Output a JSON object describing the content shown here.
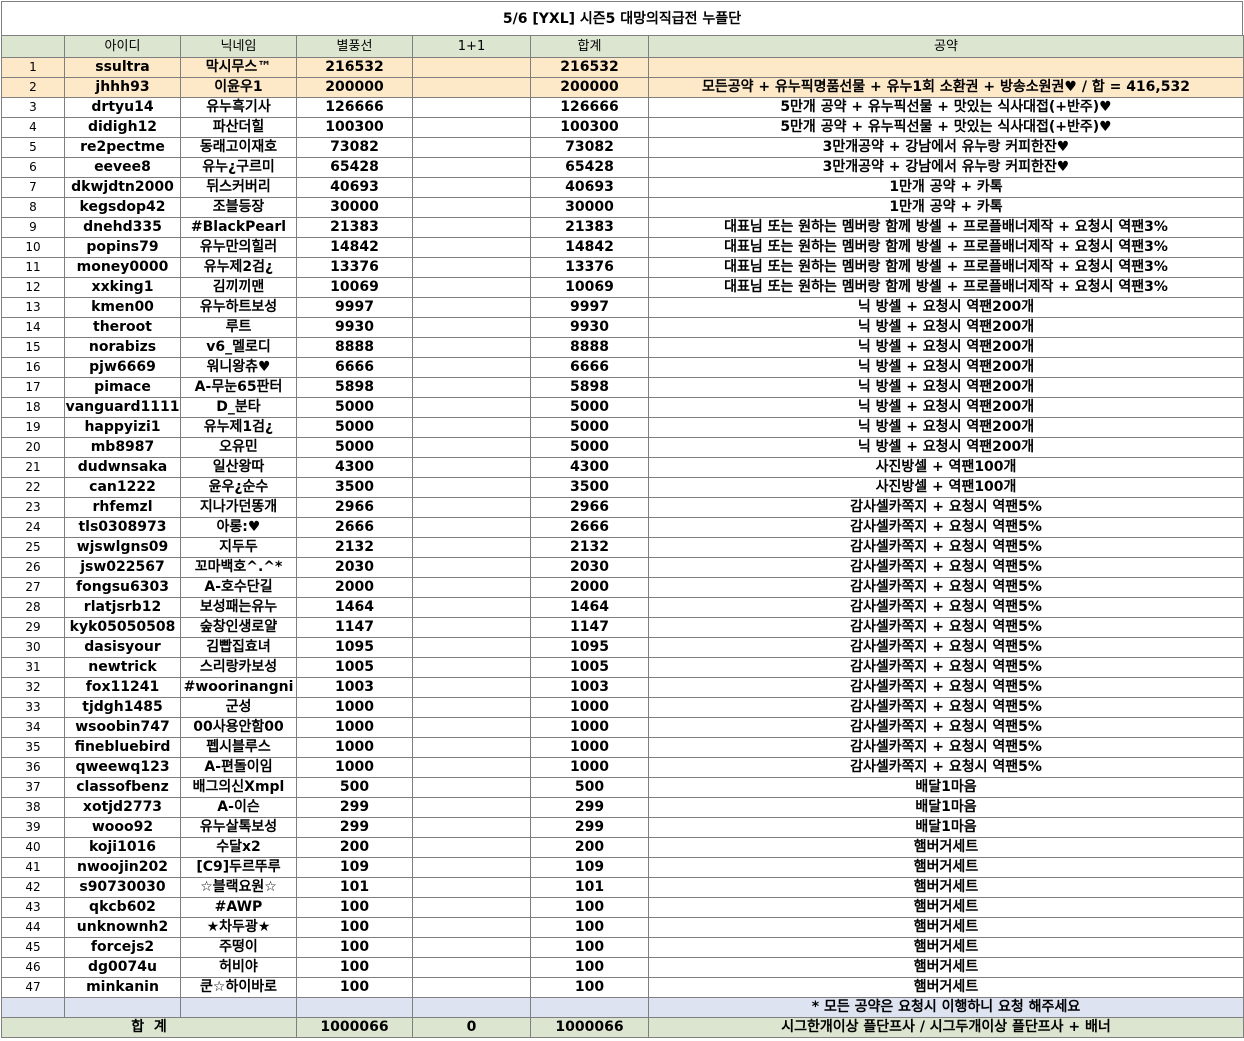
{
  "title": "5/6 [YXL] 시즌5 대망의직급전 누플단",
  "headers": [
    "",
    "아이디",
    "닉네임",
    "별풍선",
    "1+1",
    "합계",
    "공약"
  ],
  "rows": [
    {
      "no": "1",
      "id": "ssultra",
      "nick": "막시무스™",
      "stars": "216532",
      "plus": "",
      "total": "216532",
      "pledge": ""
    },
    {
      "no": "2",
      "id": "jhhh93",
      "nick": "이윤우1",
      "stars": "200000",
      "plus": "",
      "total": "200000",
      "pledge": "모든공약 + 유누픽명품선물 + 유누1회 소환권 + 방송소원권♥ / 합 = 416,532"
    },
    {
      "no": "3",
      "id": "drtyu14",
      "nick": "유누흑기사",
      "stars": "126666",
      "plus": "",
      "total": "126666",
      "pledge": "5만개 공약 + 유누픽선물 + 맛있는 식사대접(+반주)♥"
    },
    {
      "no": "4",
      "id": "didigh12",
      "nick": "파산더힐",
      "stars": "100300",
      "plus": "",
      "total": "100300",
      "pledge": "5만개 공약 + 유누픽선물 + 맛있는 식사대접(+반주)♥"
    },
    {
      "no": "5",
      "id": "re2pectme",
      "nick": "동래고이재호",
      "stars": "73082",
      "plus": "",
      "total": "73082",
      "pledge": "3만개공약 + 강남에서 유누랑 커피한잔♥"
    },
    {
      "no": "6",
      "id": "eevee8",
      "nick": "유누¿구르미",
      "stars": "65428",
      "plus": "",
      "total": "65428",
      "pledge": "3만개공약 + 강남에서 유누랑 커피한잔♥"
    },
    {
      "no": "7",
      "id": "dkwjdtn2000",
      "nick": "뒤스커버리",
      "stars": "40693",
      "plus": "",
      "total": "40693",
      "pledge": "1만개 공약 + 카톡"
    },
    {
      "no": "8",
      "id": "kegsdop42",
      "nick": "조블등장",
      "stars": "30000",
      "plus": "",
      "total": "30000",
      "pledge": "1만개 공약 + 카톡"
    },
    {
      "no": "9",
      "id": "dnehd335",
      "nick": "#BlackPearl",
      "stars": "21383",
      "plus": "",
      "total": "21383",
      "pledge": "대표님 또는 원하는 멤버랑 함께 방셀 + 프로플배너제작 + 요청시 역팬3%"
    },
    {
      "no": "10",
      "id": "popins79",
      "nick": "유누만의힐러",
      "stars": "14842",
      "plus": "",
      "total": "14842",
      "pledge": "대표님 또는 원하는 멤버랑 함께 방셀 + 프로플배너제작 + 요청시 역팬3%"
    },
    {
      "no": "11",
      "id": "money0000",
      "nick": "유누제2검¿",
      "stars": "13376",
      "plus": "",
      "total": "13376",
      "pledge": "대표님 또는 원하는 멤버랑 함께 방셀 + 프로플배너제작 + 요청시 역팬3%"
    },
    {
      "no": "12",
      "id": "xxking1",
      "nick": "김끼끼맨",
      "stars": "10069",
      "plus": "",
      "total": "10069",
      "pledge": "대표님 또는 원하는 멤버랑 함께 방셀 + 프로플배너제작 + 요청시 역팬3%"
    },
    {
      "no": "13",
      "id": "kmen00",
      "nick": "유누하트보성",
      "stars": "9997",
      "plus": "",
      "total": "9997",
      "pledge": "닉 방셀 + 요청시 역팬200개"
    },
    {
      "no": "14",
      "id": "theroot",
      "nick": "루트",
      "stars": "9930",
      "plus": "",
      "total": "9930",
      "pledge": "닉 방셀 + 요청시 역팬200개"
    },
    {
      "no": "15",
      "id": "norabizs",
      "nick": "v6_멜로디",
      "stars": "8888",
      "plus": "",
      "total": "8888",
      "pledge": "닉 방셀 + 요청시 역팬200개"
    },
    {
      "no": "16",
      "id": "pjw6669",
      "nick": "워니왕츄♥",
      "stars": "6666",
      "plus": "",
      "total": "6666",
      "pledge": "닉 방셀 + 요청시 역팬200개"
    },
    {
      "no": "17",
      "id": "pimace",
      "nick": "A-무눈65판터",
      "stars": "5898",
      "plus": "",
      "total": "5898",
      "pledge": "닉 방셀 + 요청시 역팬200개"
    },
    {
      "no": "18",
      "id": "vanguard1111",
      "nick": "D_분타",
      "stars": "5000",
      "plus": "",
      "total": "5000",
      "pledge": "닉 방셀 + 요청시 역팬200개"
    },
    {
      "no": "19",
      "id": "happyizi1",
      "nick": "유누제1검¿",
      "stars": "5000",
      "plus": "",
      "total": "5000",
      "pledge": "닉 방셀 + 요청시 역팬200개"
    },
    {
      "no": "20",
      "id": "mb8987",
      "nick": "오유민",
      "stars": "5000",
      "plus": "",
      "total": "5000",
      "pledge": "닉 방셀 + 요청시 역팬200개"
    },
    {
      "no": "21",
      "id": "dudwnsaka",
      "nick": "일산왕따",
      "stars": "4300",
      "plus": "",
      "total": "4300",
      "pledge": "사진방셀 + 역팬100개"
    },
    {
      "no": "22",
      "id": "can1222",
      "nick": "윤우¿순수",
      "stars": "3500",
      "plus": "",
      "total": "3500",
      "pledge": "사진방셀 + 역팬100개"
    },
    {
      "no": "23",
      "id": "rhfemzl",
      "nick": "지나가던똥개",
      "stars": "2966",
      "plus": "",
      "total": "2966",
      "pledge": "감사셀카쪽지 + 요청시 역팬5%"
    },
    {
      "no": "24",
      "id": "tls0308973",
      "nick": "아롱:♥",
      "stars": "2666",
      "plus": "",
      "total": "2666",
      "pledge": "감사셀카쪽지 + 요청시 역팬5%"
    },
    {
      "no": "25",
      "id": "wjswlgns09",
      "nick": "지두두",
      "stars": "2132",
      "plus": "",
      "total": "2132",
      "pledge": "감사셀카쪽지 + 요청시 역팬5%"
    },
    {
      "no": "26",
      "id": "jsw022567",
      "nick": "꼬마백호^.^*",
      "stars": "2030",
      "plus": "",
      "total": "2030",
      "pledge": "감사셀카쪽지 + 요청시 역팬5%"
    },
    {
      "no": "27",
      "id": "fongsu6303",
      "nick": "A-호수단길",
      "stars": "2000",
      "plus": "",
      "total": "2000",
      "pledge": "감사셀카쪽지 + 요청시 역팬5%"
    },
    {
      "no": "28",
      "id": "rlatjsrb12",
      "nick": "보성패는유누",
      "stars": "1464",
      "plus": "",
      "total": "1464",
      "pledge": "감사셀카쪽지 + 요청시 역팬5%"
    },
    {
      "no": "29",
      "id": "kyk05050508",
      "nick": "숲창인생로얄",
      "stars": "1147",
      "plus": "",
      "total": "1147",
      "pledge": "감사셀카쪽지 + 요청시 역팬5%"
    },
    {
      "no": "30",
      "id": "dasisyour",
      "nick": "김빱집효녀",
      "stars": "1095",
      "plus": "",
      "total": "1095",
      "pledge": "감사셀카쪽지 + 요청시 역팬5%"
    },
    {
      "no": "31",
      "id": "newtrick",
      "nick": "스리랑카보성",
      "stars": "1005",
      "plus": "",
      "total": "1005",
      "pledge": "감사셀카쪽지 + 요청시 역팬5%"
    },
    {
      "no": "32",
      "id": "fox11241",
      "nick": "#woorinangni",
      "stars": "1003",
      "plus": "",
      "total": "1003",
      "pledge": "감사셀카쪽지 + 요청시 역팬5%"
    },
    {
      "no": "33",
      "id": "tjdgh1485",
      "nick": "군성",
      "stars": "1000",
      "plus": "",
      "total": "1000",
      "pledge": "감사셀카쪽지 + 요청시 역팬5%"
    },
    {
      "no": "34",
      "id": "wsoobin747",
      "nick": "00사용안함00",
      "stars": "1000",
      "plus": "",
      "total": "1000",
      "pledge": "감사셀카쪽지 + 요청시 역팬5%"
    },
    {
      "no": "35",
      "id": "finebluebird",
      "nick": "펩시블루스",
      "stars": "1000",
      "plus": "",
      "total": "1000",
      "pledge": "감사셀카쪽지 + 요청시 역팬5%"
    },
    {
      "no": "36",
      "id": "qweewq123",
      "nick": "A-편돌이임",
      "stars": "1000",
      "plus": "",
      "total": "1000",
      "pledge": "감사셀카쪽지 + 요청시 역팬5%"
    },
    {
      "no": "37",
      "id": "classofbenz",
      "nick": "배그의신Xmpl",
      "stars": "500",
      "plus": "",
      "total": "500",
      "pledge": "배달1마음"
    },
    {
      "no": "38",
      "id": "xotjd2773",
      "nick": "A-이슨",
      "stars": "299",
      "plus": "",
      "total": "299",
      "pledge": "배달1마음"
    },
    {
      "no": "39",
      "id": "wooo92",
      "nick": "유누살톡보성",
      "stars": "299",
      "plus": "",
      "total": "299",
      "pledge": "배달1마음"
    },
    {
      "no": "40",
      "id": "koji1016",
      "nick": "수달x2",
      "stars": "200",
      "plus": "",
      "total": "200",
      "pledge": "햄버거세트"
    },
    {
      "no": "41",
      "id": "nwoojin202",
      "nick": "[C9]두르뚜루",
      "stars": "109",
      "plus": "",
      "total": "109",
      "pledge": "햄버거세트"
    },
    {
      "no": "42",
      "id": "s90730030",
      "nick": "☆블랙요원☆",
      "stars": "101",
      "plus": "",
      "total": "101",
      "pledge": "햄버거세트"
    },
    {
      "no": "43",
      "id": "qkcb602",
      "nick": "#AWP",
      "stars": "100",
      "plus": "",
      "total": "100",
      "pledge": "햄버거세트"
    },
    {
      "no": "44",
      "id": "unknownh2",
      "nick": "★차두광★",
      "stars": "100",
      "plus": "",
      "total": "100",
      "pledge": "햄버거세트"
    },
    {
      "no": "45",
      "id": "forcejs2",
      "nick": "주떵이",
      "stars": "100",
      "plus": "",
      "total": "100",
      "pledge": "햄버거세트"
    },
    {
      "no": "46",
      "id": "dg0074u",
      "nick": "허비야",
      "stars": "100",
      "plus": "",
      "total": "100",
      "pledge": "햄버거세트"
    },
    {
      "no": "47",
      "id": "minkanin",
      "nick": "쿤☆하이바로",
      "stars": "100",
      "plus": "",
      "total": "100",
      "pledge": "햄버거세트"
    }
  ],
  "note": "* 모든 공약은 요청시 이행하니 요청 해주세요",
  "footer": {
    "label": "합  계",
    "stars": "1000066",
    "plus": "0",
    "total": "1000066",
    "pledge": "시그한개이상 플단프사 / 시그두개이상 플단프사 + 배너"
  },
  "colors": {
    "header_bg": "#dbe5d0",
    "highlight_bg": "#fde9c8",
    "note_bg": "#dde3f1",
    "border": "#7f7f7f"
  }
}
